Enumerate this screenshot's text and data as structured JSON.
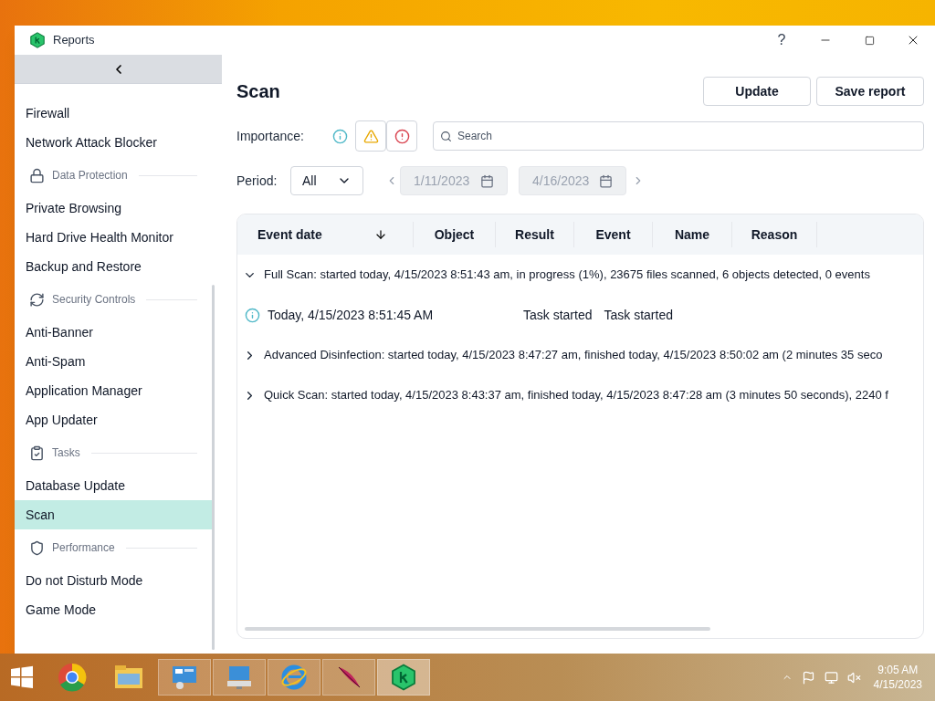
{
  "window": {
    "title": "Reports",
    "help": "?"
  },
  "sidebar": {
    "items": [
      {
        "kind": "item",
        "label": "Firewall",
        "selected": false
      },
      {
        "kind": "item",
        "label": "Network Attack Blocker",
        "selected": false
      },
      {
        "kind": "section",
        "label": "Data Protection"
      },
      {
        "kind": "item",
        "label": "Private Browsing",
        "selected": false
      },
      {
        "kind": "item",
        "label": "Hard Drive Health Monitor",
        "selected": false
      },
      {
        "kind": "item",
        "label": "Backup and Restore",
        "selected": false
      },
      {
        "kind": "section",
        "label": "Security Controls"
      },
      {
        "kind": "item",
        "label": "Anti-Banner",
        "selected": false
      },
      {
        "kind": "item",
        "label": "Anti-Spam",
        "selected": false
      },
      {
        "kind": "item",
        "label": "Application Manager",
        "selected": false
      },
      {
        "kind": "item",
        "label": "App Updater",
        "selected": false
      },
      {
        "kind": "section",
        "label": "Tasks"
      },
      {
        "kind": "item",
        "label": "Database Update",
        "selected": false
      },
      {
        "kind": "item",
        "label": "Scan",
        "selected": true
      },
      {
        "kind": "section",
        "label": "Performance"
      },
      {
        "kind": "item",
        "label": "Do not Disturb Mode",
        "selected": false
      },
      {
        "kind": "item",
        "label": "Game Mode",
        "selected": false
      }
    ]
  },
  "page": {
    "title": "Scan",
    "buttons": [
      "Update",
      "Save report"
    ]
  },
  "importance": {
    "label": "Importance:",
    "filters": [
      {
        "kind": "info",
        "selected": false
      },
      {
        "kind": "warning",
        "selected": true
      },
      {
        "kind": "error",
        "selected": true
      }
    ]
  },
  "search": {
    "placeholder": "Search"
  },
  "period": {
    "label": "Period:",
    "value": "All",
    "from": "1/11/2023",
    "to": "4/16/2023",
    "disabled": true
  },
  "table": {
    "columns": [
      "Event date",
      "Object",
      "Result",
      "Event",
      "Name",
      "Reason"
    ],
    "rows": [
      {
        "kind": "group",
        "expanded": true,
        "text": "Full Scan: started today, 4/15/2023 8:51:43 am, in progress (1%), 23675 files scanned, 6 objects detected, 0 events"
      },
      {
        "kind": "event",
        "date": "Today, 4/15/2023 8:51:45 AM",
        "result": "Task started",
        "event": "Task started"
      },
      {
        "kind": "group",
        "expanded": false,
        "text": "Advanced Disinfection: started today, 4/15/2023 8:47:27 am, finished today, 4/15/2023 8:50:02 am (2 minutes 35 seco"
      },
      {
        "kind": "group",
        "expanded": false,
        "text": "Quick Scan: started today, 4/15/2023 8:43:37 am, finished today, 4/15/2023 8:47:28 am (3 minutes 50 seconds), 2240 f"
      }
    ]
  },
  "taskbar": {
    "time": "9:05 AM",
    "date": "4/15/2023"
  }
}
